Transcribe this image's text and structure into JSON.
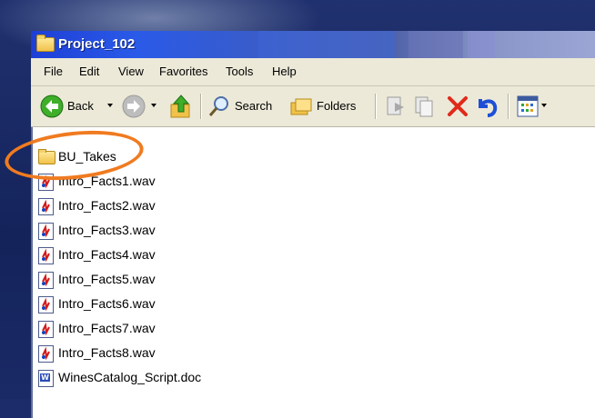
{
  "window": {
    "title": "Project_102"
  },
  "menu": [
    "File",
    "Edit",
    "View",
    "Favorites",
    "Tools",
    "Help"
  ],
  "toolbar": {
    "back_label": "Back",
    "search_label": "Search",
    "folders_label": "Folders"
  },
  "files": [
    {
      "name": "BU_Takes",
      "type": "folder"
    },
    {
      "name": "Intro_Facts1.wav",
      "type": "wav"
    },
    {
      "name": "Intro_Facts2.wav",
      "type": "wav"
    },
    {
      "name": "Intro_Facts3.wav",
      "type": "wav"
    },
    {
      "name": "Intro_Facts4.wav",
      "type": "wav"
    },
    {
      "name": "Intro_Facts5.wav",
      "type": "wav"
    },
    {
      "name": "Intro_Facts6.wav",
      "type": "wav"
    },
    {
      "name": "Intro_Facts7.wav",
      "type": "wav"
    },
    {
      "name": "Intro_Facts8.wav",
      "type": "wav"
    },
    {
      "name": "WinesCatalog_Script.doc",
      "type": "doc"
    }
  ],
  "colors": {
    "highlight": "#f07b20",
    "titlebar": "#2a5ae8",
    "chrome": "#ece9d8"
  },
  "icons": {
    "back": "back-arrow-icon",
    "forward": "forward-arrow-icon",
    "up": "up-folder-icon",
    "search": "search-icon",
    "folders": "folders-icon",
    "move": "move-to-icon",
    "copy": "copy-to-icon",
    "delete": "delete-icon",
    "undo": "undo-icon",
    "views": "views-icon"
  },
  "annotation": {
    "shape": "ellipse",
    "target": "BU_Takes"
  }
}
